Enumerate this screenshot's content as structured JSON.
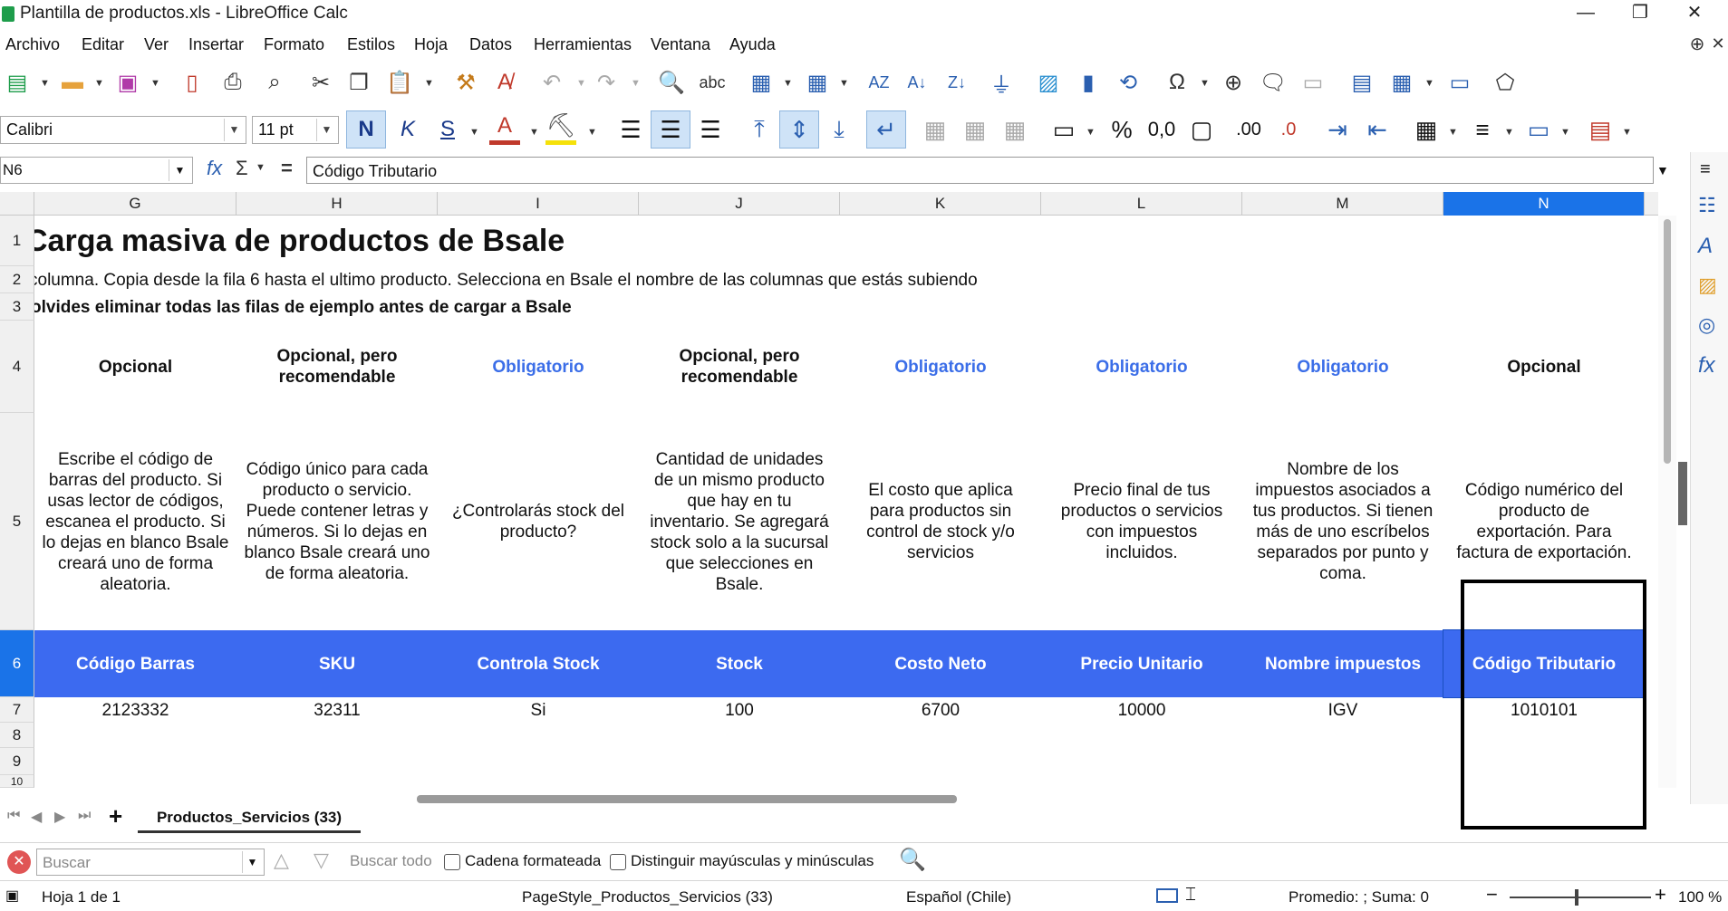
{
  "window": {
    "title": "Plantilla de productos.xls - LibreOffice Calc",
    "minimize": "—",
    "restore": "❐",
    "close": "✕"
  },
  "menu": [
    "Archivo",
    "Editar",
    "Ver",
    "Insertar",
    "Formato",
    "Estilos",
    "Hoja",
    "Datos",
    "Herramientas",
    "Ventana",
    "Ayuda"
  ],
  "toolbar": {
    "font_name": "Calibri",
    "font_size": "11 pt",
    "bold": "N",
    "italic": "K",
    "underline": "S",
    "percent": "%",
    "number": "0,0",
    "decimals_add": ".00",
    "decimals_del": ".0"
  },
  "formula": {
    "cell_ref": "N6",
    "fx": "fx",
    "sigma": "Σ",
    "equals": "=",
    "content": "Código Tributario"
  },
  "columns": [
    "G",
    "H",
    "I",
    "J",
    "K",
    "L",
    "M",
    "N"
  ],
  "selected_column": "N",
  "rows": [
    "1",
    "2",
    "3",
    "4",
    "5",
    "6",
    "7",
    "8",
    "9",
    "10"
  ],
  "selected_row": "6",
  "sheet": {
    "title": "Carga masiva de productos de Bsale",
    "subtitle": "columna. Copia desde la fila 6 hasta el ultimo producto. Selecciona en Bsale el nombre de las columnas que estás subiendo",
    "warning": "olvides eliminar todas las filas de ejemplo antes de cargar a Bsale",
    "labels": [
      "Opcional",
      "Opcional, pero recomendable",
      "Obligatorio",
      "Opcional, pero recomendable",
      "Obligatorio",
      "Obligatorio",
      "Obligatorio",
      "Opcional"
    ],
    "descriptions": [
      "Escribe el código de barras del producto. Si usas lector de códigos, escanea el producto. Si lo dejas en blanco Bsale creará uno de forma aleatoria.",
      "Código único para cada producto o servicio. Puede contener letras y números. Si lo dejas en blanco Bsale creará uno de forma aleatoria.",
      "¿Controlarás stock del producto?",
      "Cantidad de unidades de un mismo producto que hay en tu inventario. Se agregará stock solo a la sucursal que selecciones en Bsale.",
      "El costo que aplica para productos sin control de stock y/o servicios",
      "Precio final de tus productos o servicios con impuestos incluidos.",
      "Nombre de los impuestos asociados a tus productos. Si tienen más de uno escríbelos separados por punto y coma.",
      "Código numérico del producto de exportación. Para factura de exportación."
    ],
    "headers": [
      "Código Barras",
      "SKU",
      "Controla Stock",
      "Stock",
      "Costo Neto",
      "Precio Unitario",
      "Nombre impuestos",
      "Código Tributario"
    ],
    "example_row": [
      "2123332",
      "32311",
      "Si",
      "100",
      "6700",
      "10000",
      "IGV",
      "1010101"
    ]
  },
  "tabs": {
    "add": "+",
    "active": "Productos_Servicios (33)"
  },
  "find": {
    "placeholder": "Buscar",
    "find_all": "Buscar todo",
    "formatted": "Cadena formateada",
    "match_case": "Distinguir mayúsculas y minúsculas"
  },
  "status": {
    "sheet": "Hoja 1 de 1",
    "page_style": "PageStyle_Productos_Servicios (33)",
    "language": "Español (Chile)",
    "summary": "Promedio: ; Suma: 0",
    "zoom": "100 %",
    "minus": "−",
    "plus": "+"
  },
  "colors": {
    "header_fill": "#3c6af0",
    "required_text": "#3b6ee8",
    "selection": "#1a73e8"
  }
}
